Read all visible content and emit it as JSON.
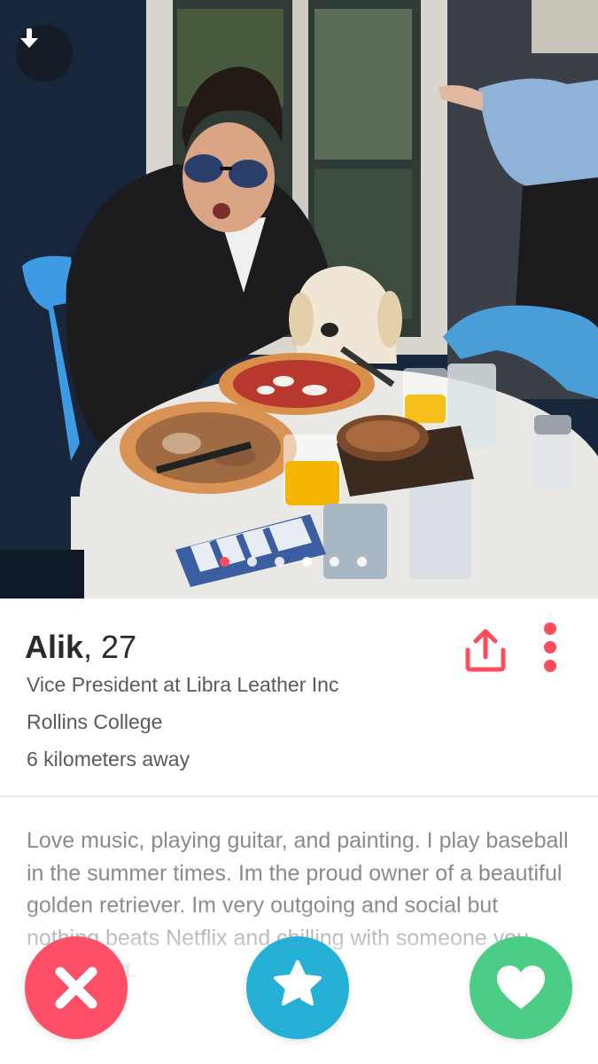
{
  "profile": {
    "name": "Alik",
    "separator": ", ",
    "age": "27",
    "job": "Vice President at Libra Leather Inc",
    "school": "Rollins College",
    "distance": "6 kilometers away",
    "bio": "Love music, playing guitar, and painting. I play baseball in the summer times. Im the proud owner of a beautiful golden retriever. Im very outgoing and social but nothing beats Netflix and chilling with someone you care about."
  },
  "photo": {
    "count": 6,
    "active_index": 0
  },
  "icons": {
    "back": "arrow-down-icon",
    "share": "share-icon",
    "more": "more-vertical-icon",
    "nope": "close-icon",
    "super_like": "star-icon",
    "like": "heart-icon"
  },
  "colors": {
    "accent": "#fd4c5c",
    "nope": "#fd5068",
    "super_like": "#27b0d6",
    "like": "#4ccd85"
  }
}
